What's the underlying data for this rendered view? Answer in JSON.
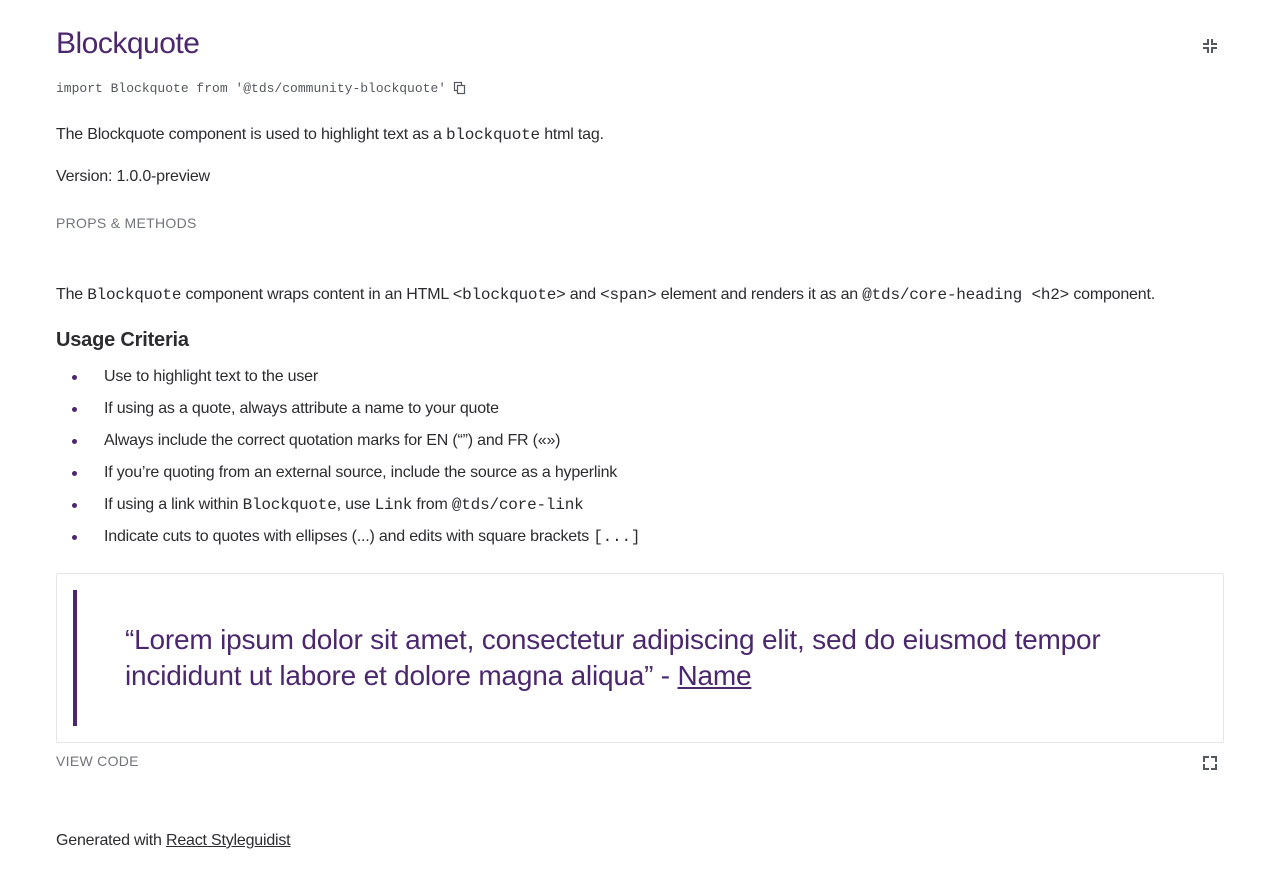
{
  "header": {
    "title": "Blockquote",
    "collapse_icon": "collapse-icon"
  },
  "import_line": {
    "code": "import Blockquote from '@tds/community-blockquote'",
    "copy_icon": "copy-icon"
  },
  "intro": {
    "text_before": "The Blockquote component is used to highlight text as a ",
    "code": "blockquote",
    "text_after": " html tag.",
    "version": "Version: 1.0.0-preview"
  },
  "props_link": "PROPS & METHODS",
  "description": {
    "t1": "The ",
    "c1": "Blockquote",
    "t2": " component wraps content in an HTML ",
    "c2": "<blockquote>",
    "t3": " and ",
    "c3": "<span>",
    "t4": " element and renders it as an ",
    "c4": "@tds/core-heading <h2>",
    "t5": " component."
  },
  "usage": {
    "heading": "Usage Criteria",
    "items": [
      "Use to highlight text to the user",
      "If using as a quote, always attribute a name to your quote",
      "Always include the correct quotation marks for EN (“”) and FR («»)",
      "If you’re quoting from an external source, include the source as a hyperlink"
    ],
    "link_item": {
      "t1": "If using a link within ",
      "c1": "Blockquote",
      "t2": ", use ",
      "c2": "Link",
      "t3": " from ",
      "c3": "@tds/core-link"
    },
    "cuts_item": {
      "text": "Indicate cuts to quotes with ellipses (...) and edits with square brackets ",
      "code": "[...]"
    }
  },
  "example": {
    "quote": "“Lorem ipsum dolor sit amet, consectetur adipiscing elit, sed do eiusmod tempor incididunt ut labore et dolore magna aliqua” - ",
    "link": "Name"
  },
  "view_code": {
    "label": "VIEW CODE",
    "expand_icon": "expand-icon"
  },
  "footer": {
    "text": "Generated with ",
    "link": "React Styleguidist"
  },
  "colors": {
    "accent": "#4b286d",
    "text": "#2a2c2e",
    "muted": "#71757b",
    "border": "#e3e6e8"
  }
}
